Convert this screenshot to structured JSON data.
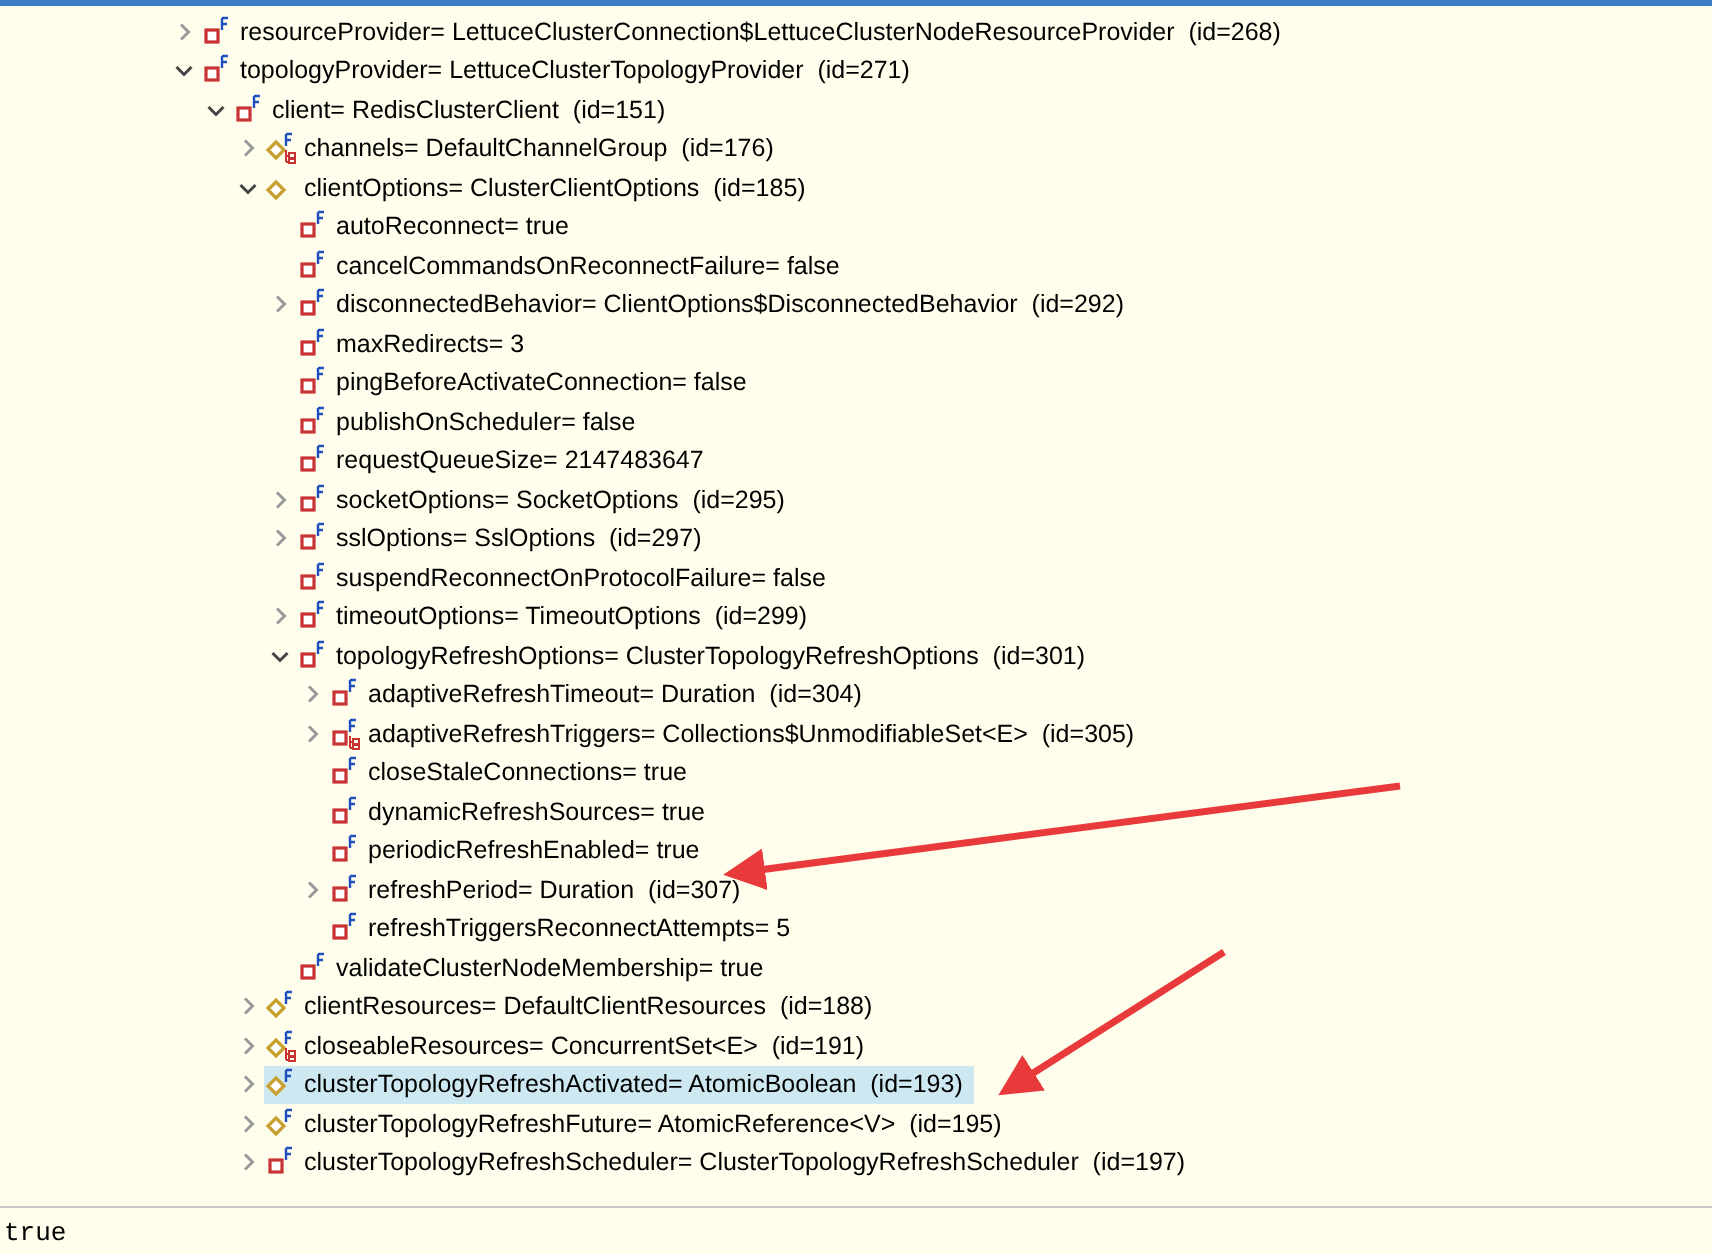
{
  "tree": [
    {
      "label": "resourceProvider= LettuceClusterConnection$LettuceClusterNodeResourceProvider  (id=268)",
      "kind": "private",
      "expanded": false,
      "selected": false
    },
    {
      "label": "topologyProvider= LettuceClusterTopologyProvider  (id=271)",
      "kind": "private",
      "expanded": true,
      "selected": false,
      "children": [
        {
          "label": "client= RedisClusterClient  (id=151)",
          "kind": "private",
          "expanded": true,
          "selected": false,
          "children": [
            {
              "label": "channels= DefaultChannelGroup  (id=176)",
              "kind": "default-collection",
              "expanded": false,
              "selected": false
            },
            {
              "label": "clientOptions= ClusterClientOptions  (id=185)",
              "kind": "default-plain",
              "expanded": true,
              "selected": false,
              "children": [
                {
                  "label": "autoReconnect= true",
                  "kind": "private",
                  "selected": false
                },
                {
                  "label": "cancelCommandsOnReconnectFailure= false",
                  "kind": "private",
                  "selected": false
                },
                {
                  "label": "disconnectedBehavior= ClientOptions$DisconnectedBehavior  (id=292)",
                  "kind": "private",
                  "expanded": false,
                  "selected": false
                },
                {
                  "label": "maxRedirects= 3",
                  "kind": "private",
                  "selected": false
                },
                {
                  "label": "pingBeforeActivateConnection= false",
                  "kind": "private",
                  "selected": false
                },
                {
                  "label": "publishOnScheduler= false",
                  "kind": "private",
                  "selected": false
                },
                {
                  "label": "requestQueueSize= 2147483647",
                  "kind": "private",
                  "selected": false
                },
                {
                  "label": "socketOptions= SocketOptions  (id=295)",
                  "kind": "private",
                  "expanded": false,
                  "selected": false
                },
                {
                  "label": "sslOptions= SslOptions  (id=297)",
                  "kind": "private",
                  "expanded": false,
                  "selected": false
                },
                {
                  "label": "suspendReconnectOnProtocolFailure= false",
                  "kind": "private",
                  "selected": false
                },
                {
                  "label": "timeoutOptions= TimeoutOptions  (id=299)",
                  "kind": "private",
                  "expanded": false,
                  "selected": false
                },
                {
                  "label": "topologyRefreshOptions= ClusterTopologyRefreshOptions  (id=301)",
                  "kind": "private",
                  "expanded": true,
                  "selected": false,
                  "children": [
                    {
                      "label": "adaptiveRefreshTimeout= Duration  (id=304)",
                      "kind": "private",
                      "expanded": false,
                      "selected": false
                    },
                    {
                      "label": "adaptiveRefreshTriggers= Collections$UnmodifiableSet<E>  (id=305)",
                      "kind": "private-collection",
                      "expanded": false,
                      "selected": false
                    },
                    {
                      "label": "closeStaleConnections= true",
                      "kind": "private",
                      "selected": false
                    },
                    {
                      "label": "dynamicRefreshSources= true",
                      "kind": "private",
                      "selected": false
                    },
                    {
                      "label": "periodicRefreshEnabled= true",
                      "kind": "private",
                      "selected": false
                    },
                    {
                      "label": "refreshPeriod= Duration  (id=307)",
                      "kind": "private",
                      "expanded": false,
                      "selected": false
                    },
                    {
                      "label": "refreshTriggersReconnectAttempts= 5",
                      "kind": "private",
                      "selected": false
                    }
                  ]
                },
                {
                  "label": "validateClusterNodeMembership= true",
                  "kind": "private",
                  "selected": false
                }
              ]
            },
            {
              "label": "clientResources= DefaultClientResources  (id=188)",
              "kind": "default",
              "expanded": false,
              "selected": false
            },
            {
              "label": "closeableResources= ConcurrentSet<E>  (id=191)",
              "kind": "default-collection",
              "expanded": false,
              "selected": false
            },
            {
              "label": "clusterTopologyRefreshActivated= AtomicBoolean  (id=193)",
              "kind": "default",
              "expanded": false,
              "selected": true
            },
            {
              "label": "clusterTopologyRefreshFuture= AtomicReference<V>  (id=195)",
              "kind": "default",
              "expanded": false,
              "selected": false
            },
            {
              "label": "clusterTopologyRefreshScheduler= ClusterTopologyRefreshScheduler  (id=197)",
              "kind": "private",
              "expanded": false,
              "selected": false
            }
          ]
        }
      ]
    }
  ],
  "detail": {
    "value": "true"
  }
}
